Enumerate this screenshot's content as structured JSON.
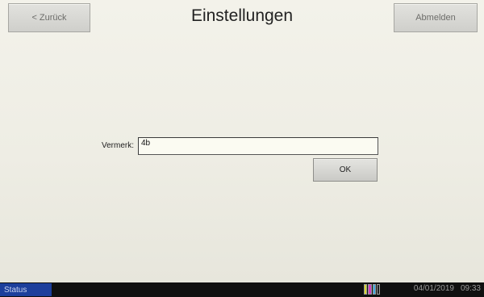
{
  "header": {
    "back_label": "< Zurück",
    "title": "Einstellungen",
    "logout_label": "Abmelden"
  },
  "form": {
    "field_label": "Vermerk:",
    "field_value": "4b",
    "ok_label": "OK"
  },
  "status_bar": {
    "status_label": "Status",
    "toner_icon": "toner-level-icon",
    "toner_colors": [
      "#d8d830",
      "#d040c0",
      "#40a8e0",
      "#202020"
    ],
    "date": "04/01/2019",
    "time": "09:33"
  },
  "colors": {
    "status_button_bg": "#1d3f9c",
    "status_bar_bg": "#101010"
  }
}
